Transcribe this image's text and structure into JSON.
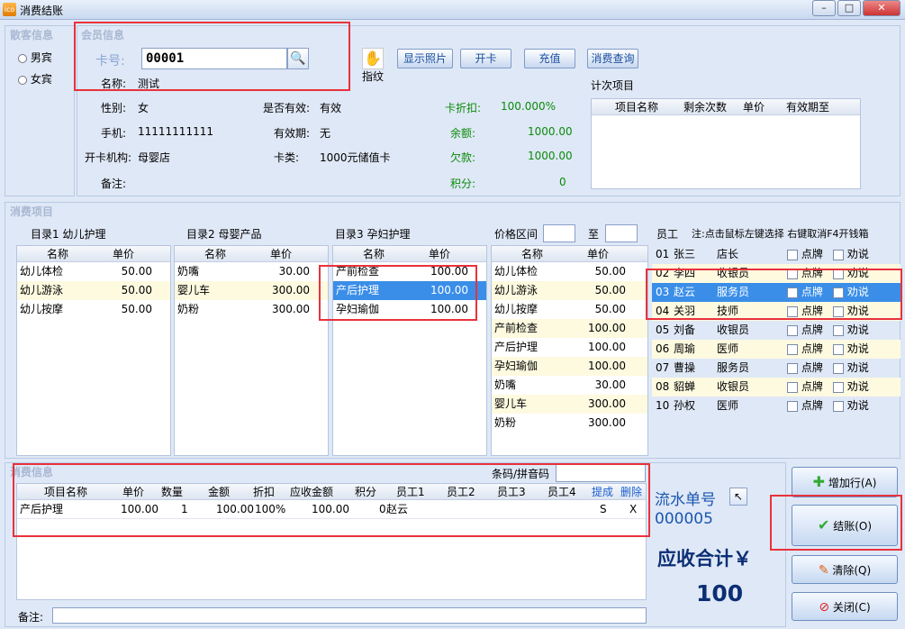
{
  "window": {
    "title": "消费结账",
    "app_icon": "ico"
  },
  "guest": {
    "section": "散客信息",
    "male": "男宾",
    "female": "女宾"
  },
  "member": {
    "section": "会员信息",
    "card_label": "卡号:",
    "card_value": "00001",
    "name_label": "名称:",
    "name_value": "测试",
    "gender_label": "性别:",
    "gender_value": "女",
    "valid_label": "是否有效:",
    "valid_value": "有效",
    "phone_label": "手机:",
    "phone_value": "11111111111",
    "expire_label": "有效期:",
    "expire_value": "无",
    "org_label": "开卡机构:",
    "org_value": "母婴店",
    "cardtype_label": "卡类:",
    "cardtype_value": "1000元储值卡",
    "remark_label": "备注:",
    "discount_label": "卡折扣:",
    "discount_value": "100.000%",
    "balance_label": "余额:",
    "balance_value": "1000.00",
    "debt_label": "欠款:",
    "debt_value": "1000.00",
    "points_label": "积分:",
    "points_value": "0"
  },
  "fingerprint_label": "指纹",
  "actions": {
    "photo": "显示照片",
    "open": "开卡",
    "recharge": "充值",
    "query": "消费查询"
  },
  "count_items": {
    "title": "计次项目",
    "headers": [
      "项目名称",
      "剩余次数",
      "单价",
      "有效期至"
    ]
  },
  "consume_section": "消费项目",
  "cat1": {
    "title": "目录1 幼儿护理",
    "headers": [
      "名称",
      "单价"
    ],
    "rows": [
      [
        "幼儿体检",
        "50.00"
      ],
      [
        "幼儿游泳",
        "50.00"
      ],
      [
        "幼儿按摩",
        "50.00"
      ]
    ]
  },
  "cat2": {
    "title": "目录2 母婴产品",
    "headers": [
      "名称",
      "单价"
    ],
    "rows": [
      [
        "奶嘴",
        "30.00"
      ],
      [
        "婴儿车",
        "300.00"
      ],
      [
        "奶粉",
        "300.00"
      ]
    ]
  },
  "cat3": {
    "title": "目录3 孕妇护理",
    "headers": [
      "名称",
      "单价"
    ],
    "rows": [
      [
        "产前检查",
        "100.00"
      ],
      [
        "产后护理",
        "100.00"
      ],
      [
        "孕妇瑜伽",
        "100.00"
      ]
    ]
  },
  "price_range": {
    "label": "价格区间",
    "to": "至",
    "headers": [
      "名称",
      "单价"
    ],
    "rows": [
      [
        "幼儿体检",
        "50.00"
      ],
      [
        "幼儿游泳",
        "50.00"
      ],
      [
        "幼儿按摩",
        "50.00"
      ],
      [
        "产前检查",
        "100.00"
      ],
      [
        "产后护理",
        "100.00"
      ],
      [
        "孕妇瑜伽",
        "100.00"
      ],
      [
        "奶嘴",
        "30.00"
      ],
      [
        "婴儿车",
        "300.00"
      ],
      [
        "奶粉",
        "300.00"
      ]
    ]
  },
  "staff": {
    "title": "员工",
    "note": "注:点击鼠标左键选择 右键取消F4开钱箱",
    "card_label": "点牌",
    "persuade_label": "劝说",
    "rows": [
      [
        "01",
        "张三",
        "店长"
      ],
      [
        "02",
        "李四",
        "收银员"
      ],
      [
        "03",
        "赵云",
        "服务员"
      ],
      [
        "04",
        "关羽",
        "技师"
      ],
      [
        "05",
        "刘备",
        "收银员"
      ],
      [
        "06",
        "周瑜",
        "医师"
      ],
      [
        "07",
        "曹操",
        "服务员"
      ],
      [
        "08",
        "貂蝉",
        "收银员"
      ],
      [
        "10",
        "孙权",
        "医师"
      ]
    ]
  },
  "consume_info": {
    "section": "消费信息",
    "barcode_label": "条码/拼音码",
    "headers": [
      "项目名称",
      "单价",
      "数量",
      "金额",
      "折扣",
      "应收金额",
      "积分",
      "员工1",
      "员工2",
      "员工3",
      "员工4",
      "提成",
      "删除"
    ],
    "rows": [
      [
        "产后护理",
        "100.00",
        "1",
        "100.00",
        "100%",
        "100.00",
        "0",
        "赵云",
        "",
        "",
        "",
        "S",
        "X"
      ]
    ],
    "remark_label": "备注:"
  },
  "serial": {
    "label": "流水单号",
    "value": "000005"
  },
  "total": {
    "label": "应收合计￥",
    "value": "100"
  },
  "side_buttons": {
    "add": "增加行(A)",
    "checkout": "结账(O)",
    "clear": "清除(Q)",
    "close": "关闭(C)"
  }
}
